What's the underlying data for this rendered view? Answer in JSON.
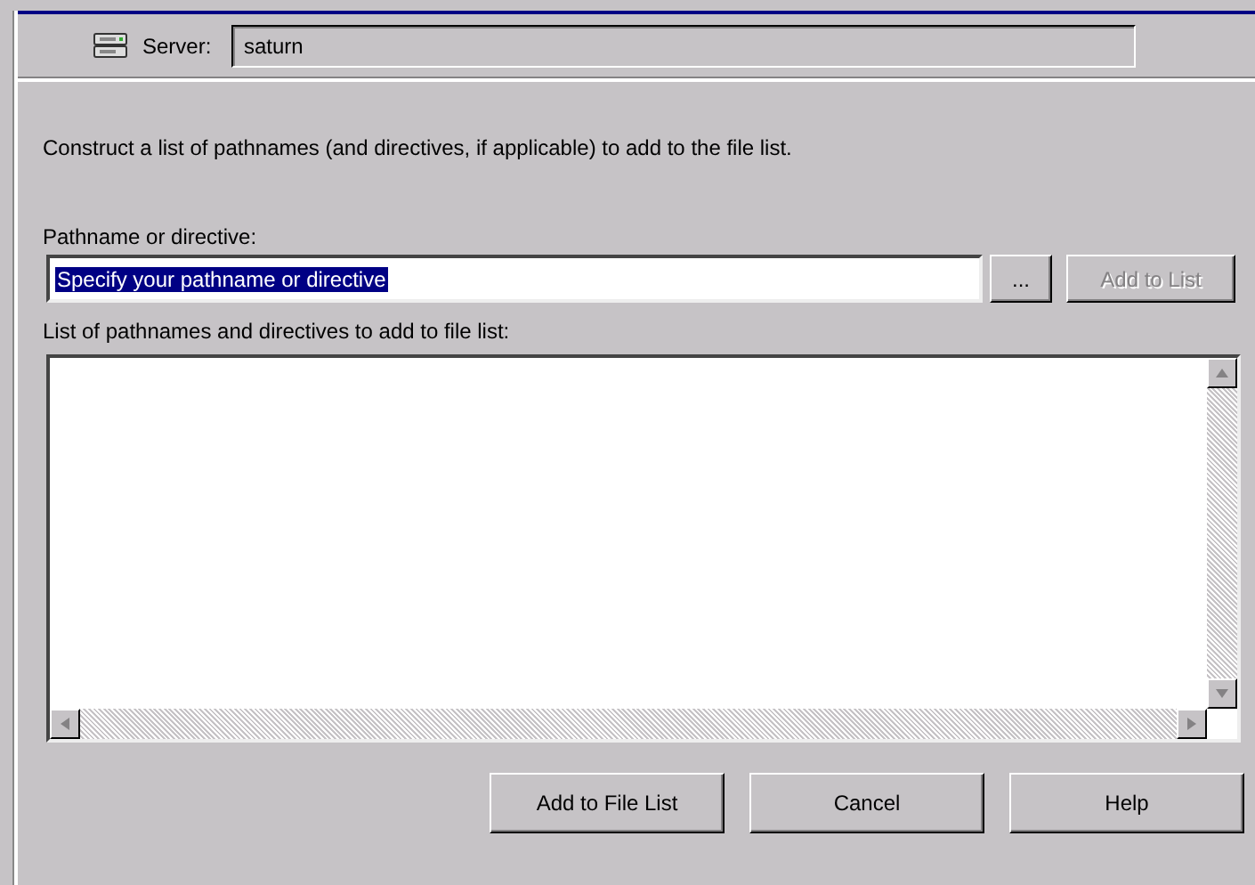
{
  "server": {
    "label": "Server:",
    "value": "saturn"
  },
  "instruction": "Construct a list of pathnames (and directives, if applicable) to add to the file list.",
  "pathname": {
    "label": "Pathname or directive:",
    "value": "Specify your pathname or directive",
    "text_selected": true
  },
  "browse_button": {
    "label": "...",
    "disabled": false
  },
  "add_to_list_button": {
    "label": "Add to List",
    "disabled": true
  },
  "list": {
    "label": "List of pathnames and directives to add to file list:"
  },
  "buttons": [
    {
      "label": "Add to File List",
      "disabled": false
    },
    {
      "label": "Cancel",
      "disabled": false
    },
    {
      "label": "Help",
      "disabled": false
    }
  ]
}
